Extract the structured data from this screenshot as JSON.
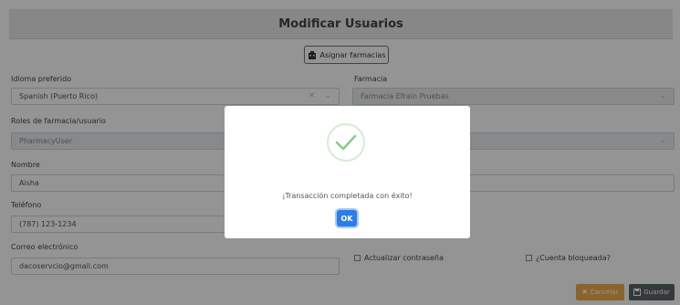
{
  "header": {
    "title": "Modificar Usuarios"
  },
  "assign_button": {
    "label": "Asignar farmacias",
    "icon": "building-icon"
  },
  "fields": {
    "language": {
      "label": "Idioma preferido",
      "value": "Spanish (Puerto Rico)"
    },
    "pharmacy": {
      "label": "Farmacia",
      "value": "Farmacia Efrain Pruebas"
    },
    "roles": {
      "label": "Roles de farmacia/usuario",
      "value": "PharmacyUser"
    },
    "name": {
      "label": "Nombre",
      "value": "Aisha"
    },
    "phone": {
      "label": "Teléfono",
      "value": "(787) 123-1234"
    },
    "email": {
      "label": "Correo electrónico",
      "value": "dacoservcio@gmail.com"
    }
  },
  "checkboxes": {
    "update_password": "Actualizar contraseña",
    "account_locked": "¿Cuenta bloqueada?"
  },
  "buttons": {
    "cancel": "Cancelar",
    "save": "Guardar"
  },
  "modal": {
    "message": "¡Transacción completada con éxito!",
    "ok": "OK"
  },
  "colors": {
    "success": "#8bc98b",
    "primary": "#2b7de9",
    "warning": "#f0ad4e",
    "secondary": "#5a6268"
  }
}
